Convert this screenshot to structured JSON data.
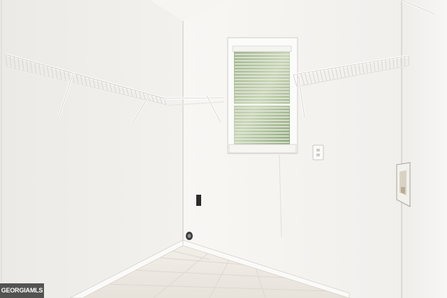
{
  "photo": {
    "watermark_text": "GEORGIAMLS"
  }
}
